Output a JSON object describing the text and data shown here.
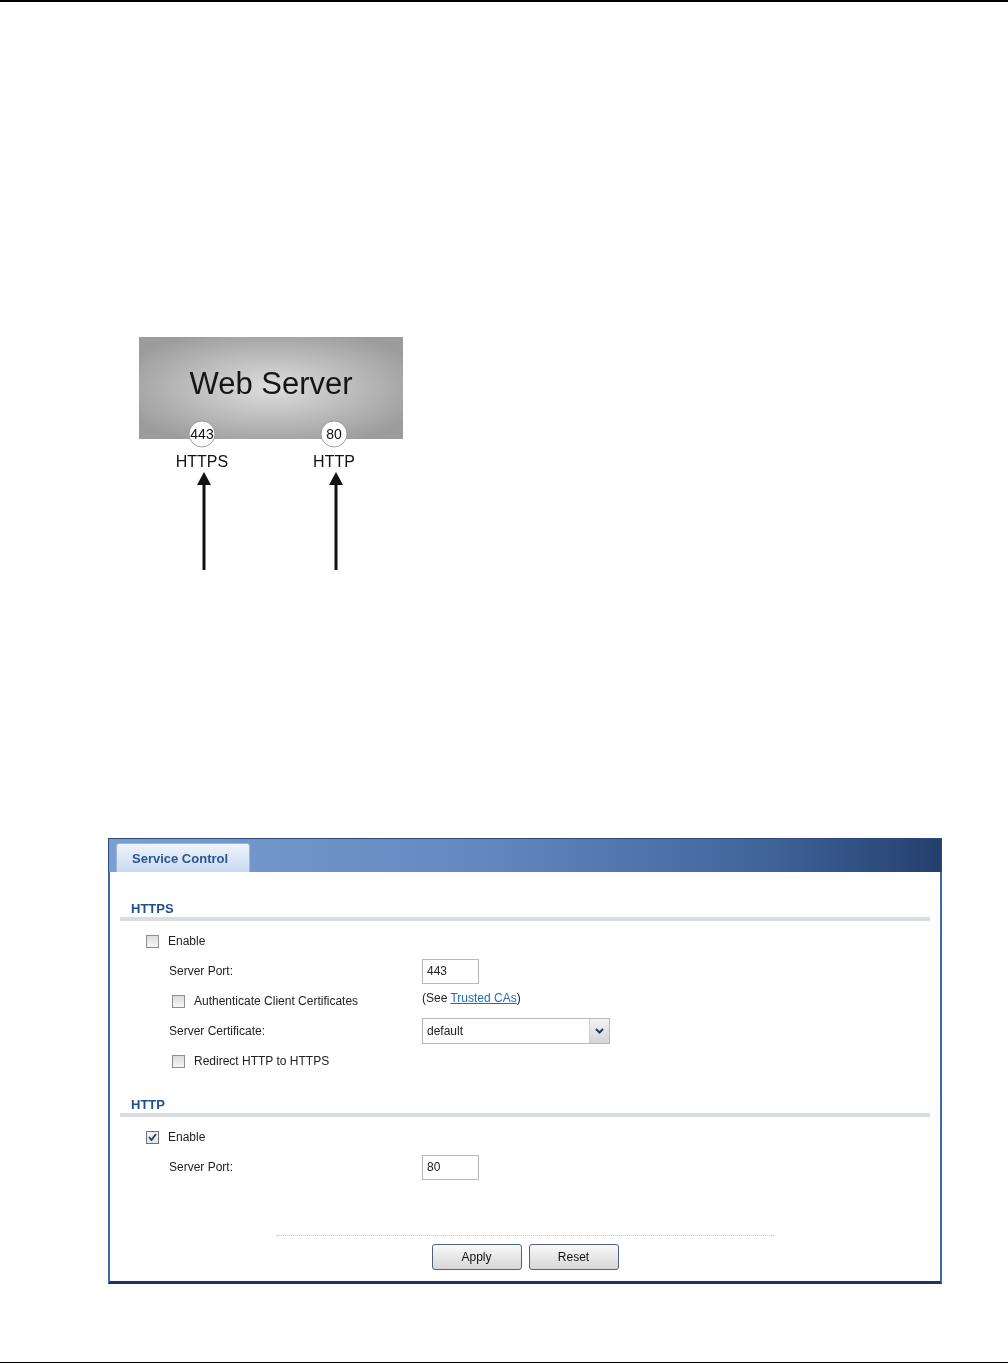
{
  "diagram": {
    "server": "Web Server",
    "ports": [
      {
        "number": "443",
        "protocol": "HTTPS"
      },
      {
        "number": "80",
        "protocol": "HTTP"
      }
    ]
  },
  "panel": {
    "tabs": [
      {
        "label": "Service Control",
        "selected": true
      }
    ],
    "sections": [
      {
        "title": "HTTPS",
        "rows": [
          {
            "kind": "checkbox",
            "label": "Enable",
            "checked": false,
            "children": [
              {
                "kind": "text",
                "label": "Server Port:",
                "value": "443"
              },
              {
                "kind": "checkbox",
                "label": "Authenticate Client Certificates",
                "checked": false,
                "note": {
                  "before": "(See",
                  "link": "Trusted CAs",
                  "after": ")"
                }
              },
              {
                "kind": "select",
                "label": "Server Certificate:",
                "value": "default"
              },
              {
                "kind": "checkbox",
                "label": "Redirect HTTP to HTTPS",
                "checked": false
              }
            ]
          }
        ]
      },
      {
        "title": "HTTP",
        "rows": [
          {
            "kind": "checkbox",
            "label": "Enable",
            "checked": true,
            "children": [
              {
                "kind": "text",
                "label": "Server Port:",
                "value": "80"
              }
            ]
          }
        ]
      }
    ],
    "buttons": [
      {
        "label": "Apply"
      },
      {
        "label": "Reset"
      }
    ]
  }
}
